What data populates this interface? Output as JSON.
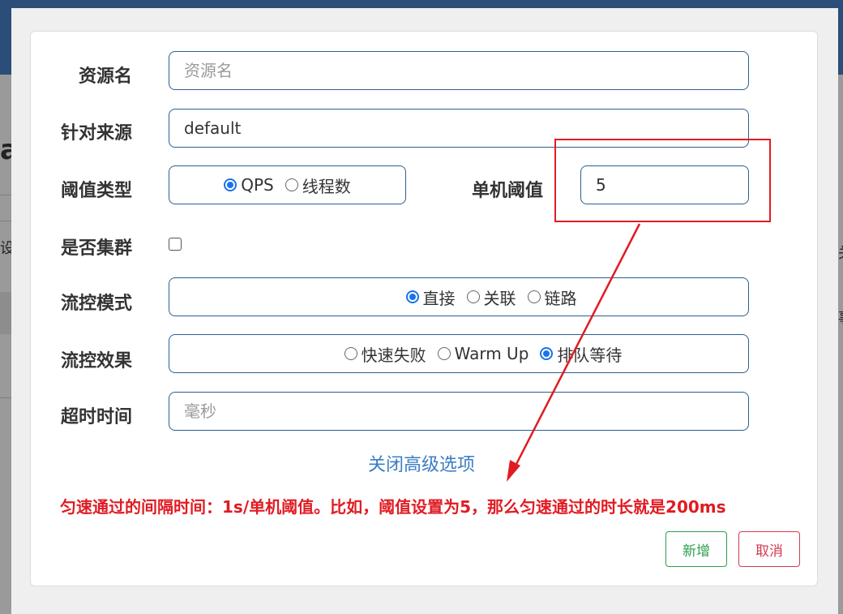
{
  "form": {
    "resource_name": {
      "label": "资源名",
      "placeholder": "资源名",
      "value": ""
    },
    "limit_app": {
      "label": "针对来源",
      "value": "default"
    },
    "grade": {
      "label": "阈值类型",
      "options": [
        "QPS",
        "线程数"
      ],
      "selected": "QPS"
    },
    "count": {
      "label": "单机阈值",
      "value": "5"
    },
    "cluster": {
      "label": "是否集群",
      "checked": false
    },
    "strategy": {
      "label": "流控模式",
      "options": [
        "直接",
        "关联",
        "链路"
      ],
      "selected": "直接"
    },
    "control_behavior": {
      "label": "流控效果",
      "options": [
        "快速失败",
        "Warm Up",
        "排队等待"
      ],
      "selected": "排队等待"
    },
    "timeout": {
      "label": "超时时间",
      "placeholder": "毫秒",
      "value": ""
    },
    "advanced_toggle": "关闭高级选项"
  },
  "annotation": {
    "note": "匀速通过的间隔时间：1s/单机阈值。比如，阈值设置为5，那么匀速通过的时长就是200ms",
    "color": "#e11b22"
  },
  "buttons": {
    "add": "新增",
    "cancel": "取消"
  },
  "background_fragments": {
    "left_letter": "a",
    "left_char": "设",
    "right_char_1": "关",
    "right_char_2": "事"
  }
}
